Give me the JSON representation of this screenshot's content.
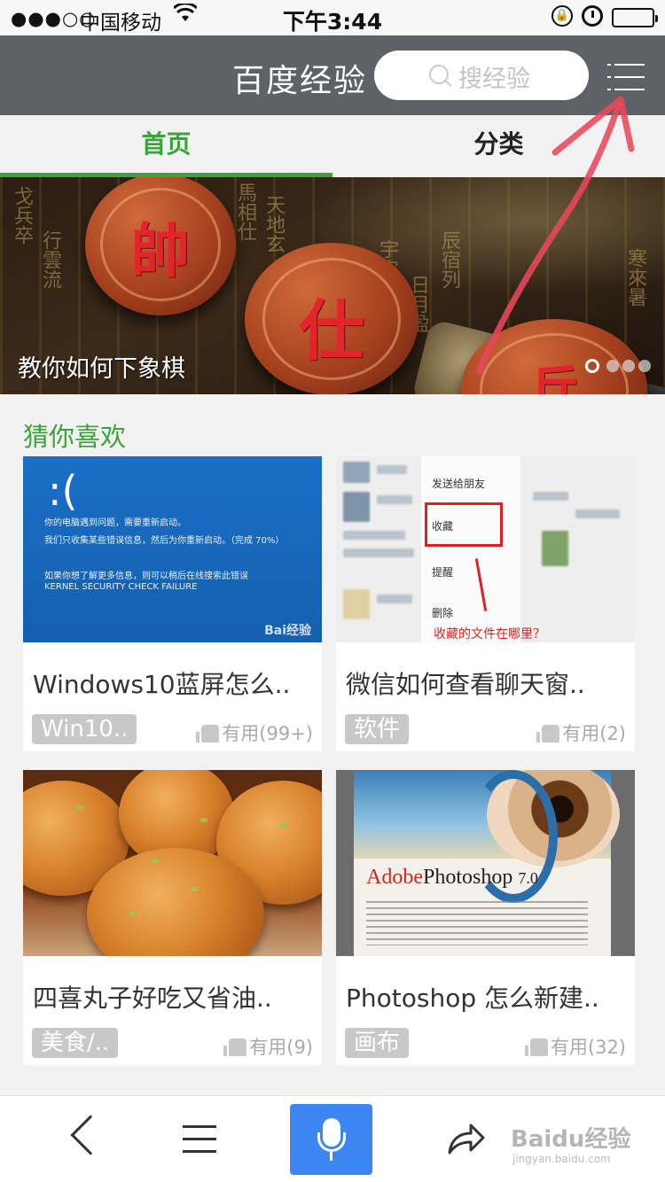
{
  "status_bar": {
    "signal": "●●●○○",
    "carrier": "中国移动",
    "time": "下午3:44"
  },
  "header": {
    "title": "百度经验",
    "search_placeholder": "搜经验"
  },
  "tabs": [
    {
      "label": "首页",
      "active": true
    },
    {
      "label": "分类",
      "active": false
    }
  ],
  "banner": {
    "caption": "教你如何下象棋",
    "pieces": [
      "帥",
      "仕",
      "兵"
    ],
    "slide_count": 4,
    "active_slide": 1
  },
  "section": {
    "title": "猜你喜欢"
  },
  "cards": [
    {
      "title": "Windows10蓝屏怎么..",
      "tag": "Win10..",
      "useful": "有用(99+)",
      "thumb_text": [
        "你的电脑遇到问题，需要重新启动。",
        "我们只收集某些错误信息，然后为你重新启动。（完成 70%）",
        "如果你想了解更多信息，则可以稍后在线搜索此错误",
        "KERNEL SECURITY CHECK FAILURE"
      ],
      "thumb_watermark": "Bai经验"
    },
    {
      "title": "微信如何查看聊天窗..",
      "tag": "软件",
      "useful": "有用(2)",
      "thumb_menu": [
        "发送给朋友",
        "收藏",
        "提醒",
        "删除"
      ],
      "thumb_red_text": "收藏的文件在哪里？"
    },
    {
      "title": "四喜丸子好吃又省油..",
      "tag": "美食/..",
      "useful": "有用(9)"
    },
    {
      "title": "Photoshop 怎么新建..",
      "tag": "画布",
      "useful": "有用(32)",
      "thumb_logo_brand": "Adobe",
      "thumb_logo_product": "Photoshop",
      "thumb_logo_version": "7.0"
    }
  ],
  "bottom_bar": {
    "watermark": "Baidu经验",
    "watermark_url": "jingyan.baidu.com"
  },
  "colors": {
    "accent_green": "#3aa43a",
    "header_gray": "#5e6166",
    "mic_blue": "#3b86f0",
    "annotation_red": "#e8485a"
  }
}
